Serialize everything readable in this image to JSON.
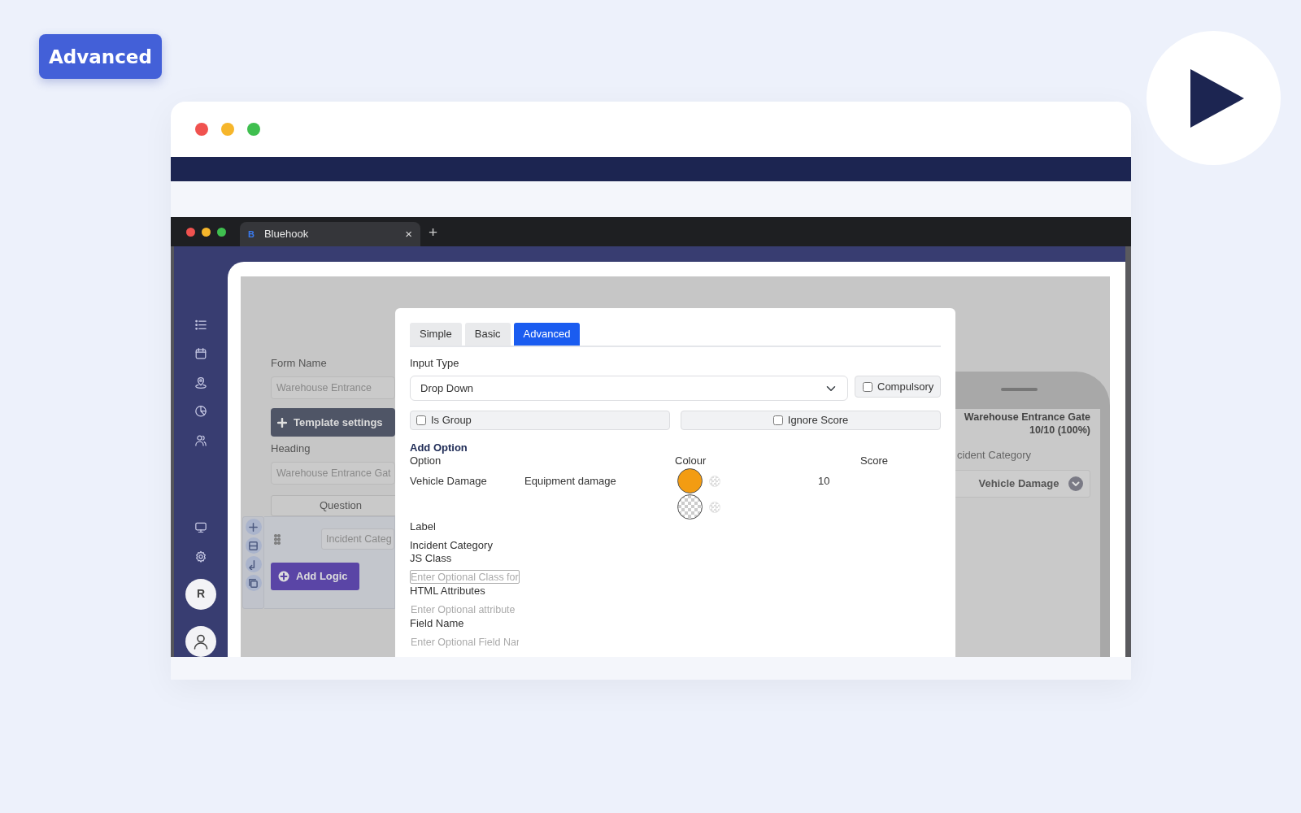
{
  "badge": "Advanced",
  "browser": {
    "favicon": "B",
    "tab_title": "Bluehook",
    "tab_close": "×",
    "new_tab": "+"
  },
  "sidebar": {
    "avatar_initial": "R"
  },
  "form": {
    "form_name_label": "Form Name",
    "form_name_value": "Warehouse Entrance",
    "template_button": "Template settings",
    "heading_label": "Heading",
    "heading_value": "Warehouse Entrance Gat",
    "question_header": "Question",
    "question_value": "Incident Categ",
    "add_logic_button": "Add Logic"
  },
  "modal": {
    "tabs": [
      {
        "label": "Simple",
        "selected": false
      },
      {
        "label": "Basic",
        "selected": false
      },
      {
        "label": "Advanced",
        "selected": true
      }
    ],
    "input_type_label": "Input Type",
    "input_type_value": "Drop Down",
    "compulsory": {
      "label": "Compulsory",
      "checked": false
    },
    "is_group": {
      "label": "Is Group",
      "checked": false
    },
    "ignore_score": {
      "label": "Ignore Score",
      "checked": false
    },
    "add_option_title": "Add Option",
    "columns": [
      "Option",
      "Colour",
      "Score"
    ],
    "options": [
      {
        "option": "Vehicle Damage",
        "label": "Equipment damage",
        "transparent": false,
        "color": "#f39c12",
        "score": "10"
      },
      {
        "transparent": true
      }
    ],
    "fields": [
      {
        "kind": "text",
        "label": "Label",
        "value": "Incident Category"
      },
      {
        "kind": "input",
        "label": "JS Class",
        "placeholder": "Enter Optional Class for",
        "focused": true
      },
      {
        "kind": "input",
        "label": "HTML Attributes",
        "placeholder": "Enter Optional attribute",
        "focused": false
      },
      {
        "kind": "input",
        "label": "Field Name",
        "placeholder": "Enter Optional Field Nar",
        "focused": false
      }
    ]
  },
  "phone": {
    "title": "Warehouse Entrance Gate",
    "score": "10/10 (100%)",
    "question": "cident Category",
    "answer": "Vehicle Damage"
  }
}
